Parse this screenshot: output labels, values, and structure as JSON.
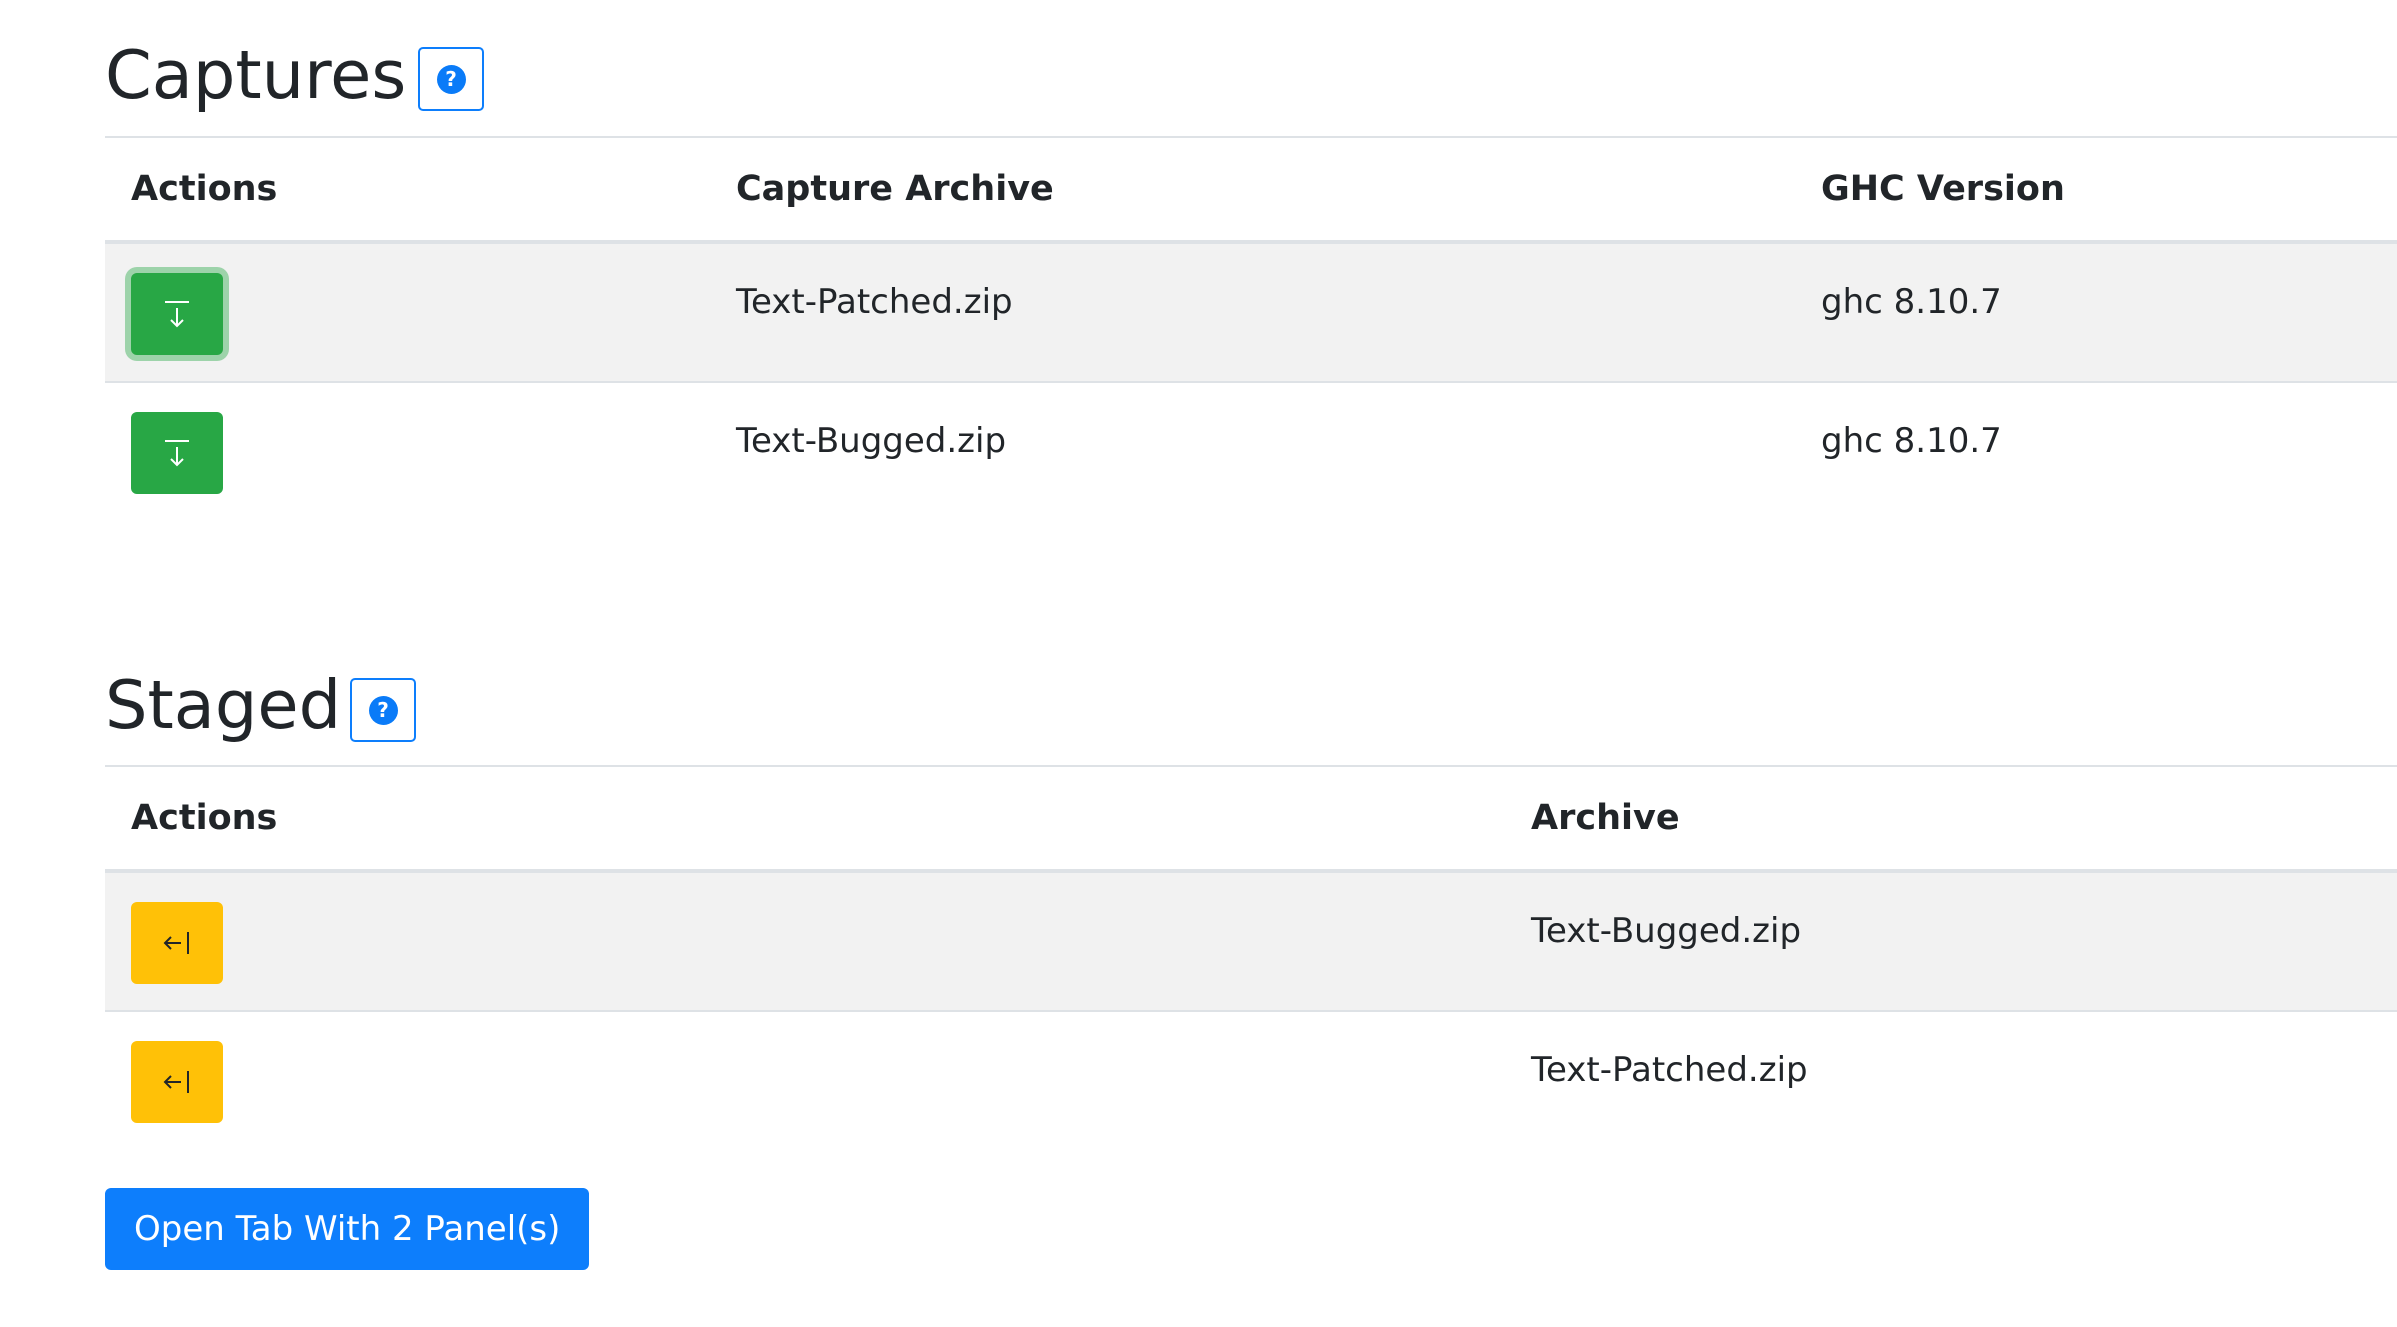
{
  "captures": {
    "title": "Captures",
    "help_glyph": "?",
    "columns": [
      "Actions",
      "Capture Archive",
      "GHC Version"
    ],
    "rows": [
      {
        "action_icon": "download-icon",
        "archive": "Text-Patched.zip",
        "ghc_version": "ghc 8.10.7"
      },
      {
        "action_icon": "download-icon",
        "archive": "Text-Bugged.zip",
        "ghc_version": "ghc 8.10.7"
      }
    ]
  },
  "staged": {
    "title": "Staged",
    "help_glyph": "?",
    "columns": [
      "Actions",
      "Archive"
    ],
    "rows": [
      {
        "action_icon": "unstage-icon",
        "archive": "Text-Bugged.zip"
      },
      {
        "action_icon": "unstage-icon",
        "archive": "Text-Patched.zip"
      }
    ]
  },
  "open_tab_button": {
    "label": "Open Tab With 2 Panel(s)"
  },
  "colors": {
    "primary": "#0d7efc",
    "download_green": "#28a745",
    "unstage_yellow": "#ffc107",
    "stripe": "#f2f2f2"
  }
}
